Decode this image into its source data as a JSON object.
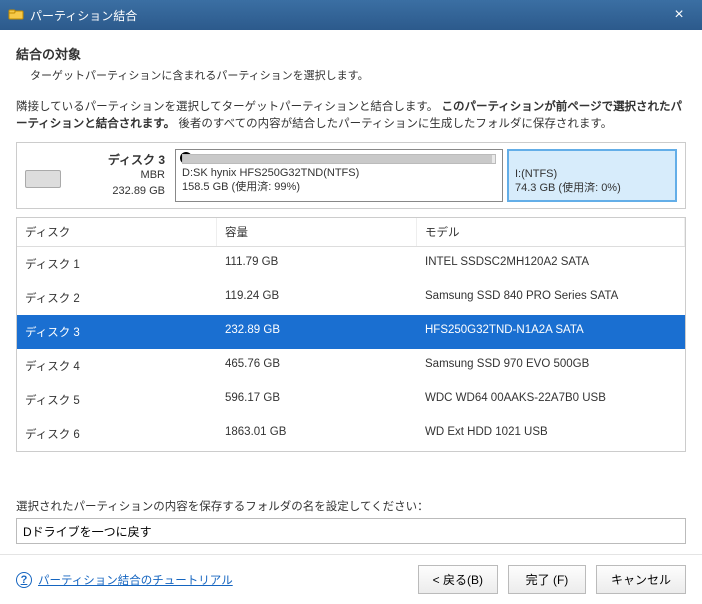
{
  "window": {
    "title": "パーティション結合"
  },
  "header": {
    "title": "結合の対象",
    "subtitle": "ターゲットパーティションに含まれるパーティションを選択します。"
  },
  "instruction": {
    "line1": "隣接しているパーティションを選択してターゲットパーティションと結合します。",
    "bold": "このパーティションが前ページで選択されたパーティションと結合されます。",
    "line2": "後者のすべての内容が結合したパーティションに生成したフォルダに保存されます。"
  },
  "selected_disk": {
    "name": "ディスク 3",
    "scheme": "MBR",
    "size": "232.89 GB",
    "partitions": [
      {
        "label": "D:SK hynix HFS250G32TND(NTFS)",
        "detail": "158.5 GB (使用済: 99%)",
        "checked": true,
        "target": false
      },
      {
        "label": "I:(NTFS)",
        "detail": "74.3 GB (使用済: 0%)",
        "checked": false,
        "target": true
      }
    ]
  },
  "table": {
    "headers": {
      "disk": "ディスク",
      "capacity": "容量",
      "model": "モデル"
    },
    "rows": [
      {
        "disk": "ディスク 1",
        "capacity": "111.79 GB",
        "model": "INTEL SSDSC2MH120A2 SATA",
        "selected": false
      },
      {
        "disk": "ディスク 2",
        "capacity": "119.24 GB",
        "model": "Samsung SSD 840 PRO Series SATA",
        "selected": false
      },
      {
        "disk": "ディスク 3",
        "capacity": "232.89 GB",
        "model": "HFS250G32TND-N1A2A SATA",
        "selected": true
      },
      {
        "disk": "ディスク 4",
        "capacity": "465.76 GB",
        "model": "Samsung SSD 970 EVO 500GB",
        "selected": false
      },
      {
        "disk": "ディスク 5",
        "capacity": "596.17 GB",
        "model": "WDC WD64 00AAKS-22A7B0 USB",
        "selected": false
      },
      {
        "disk": "ディスク 6",
        "capacity": "1863.01 GB",
        "model": "WD Ext HDD 1021 USB",
        "selected": false
      }
    ]
  },
  "folder": {
    "label": "選択されたパーティションの内容を保存するフォルダの名を設定してください：",
    "value": "Dドライブを一つに戻す"
  },
  "footer": {
    "help": "パーティション結合のチュートリアル",
    "back": "< 戻る(B)",
    "finish": "完了 (F)",
    "cancel": "キャンセル"
  }
}
